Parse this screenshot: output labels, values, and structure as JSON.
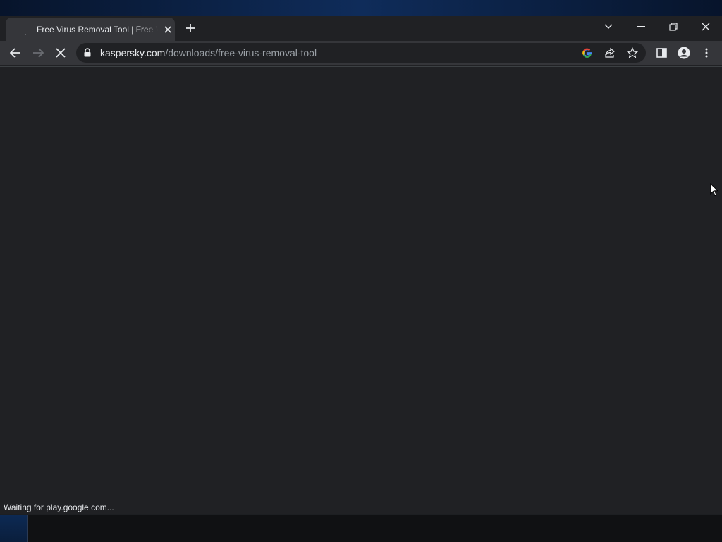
{
  "browser": {
    "tab": {
      "title": "Free Virus Removal Tool | Free Virus Removal Tool",
      "favicon": "loading-dot",
      "close_icon": "close-icon"
    },
    "new_tab_icon": "plus-icon",
    "window_controls": [
      "tab-search-chevron-icon",
      "minimize-icon",
      "restore-icon",
      "close-icon"
    ],
    "toolbar": {
      "back_icon": "arrow-left-icon",
      "forward_icon": "arrow-right-icon",
      "stop_icon": "stop-icon",
      "url_host": "kaspersky.com",
      "url_path": "/downloads/free-virus-removal-tool",
      "omnibox_icons": [
        "google-icon",
        "share-icon",
        "star-icon"
      ],
      "right_icons": [
        "side-panel-icon",
        "profile-icon",
        "kebab-menu-icon"
      ]
    },
    "status_text": "Waiting for play.google.com...",
    "colors": {
      "background": "#202124",
      "toolbar": "#35363a",
      "text": "#e8eaed",
      "muted": "#9aa0a6"
    }
  }
}
